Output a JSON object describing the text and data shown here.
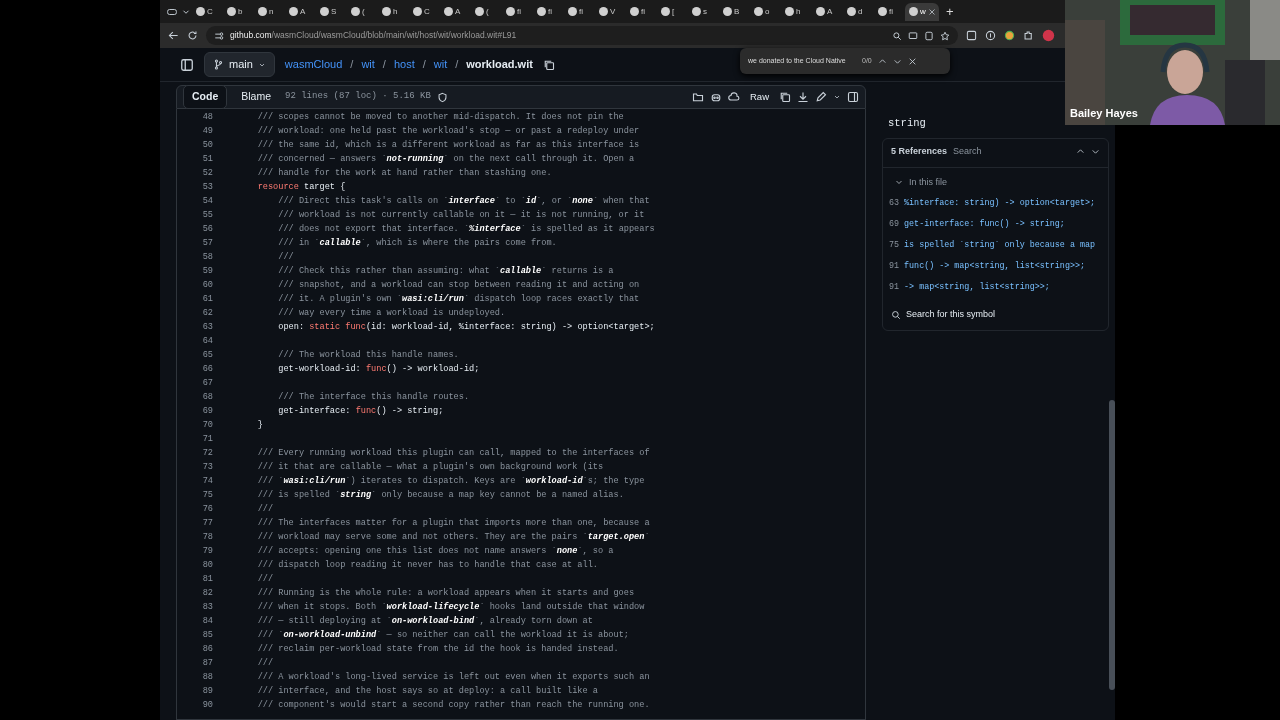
{
  "browser": {
    "tabs": [
      {
        "label": "C",
        "selected": false
      },
      {
        "label": "b",
        "selected": false
      },
      {
        "label": "n",
        "selected": false
      },
      {
        "label": "A",
        "selected": false
      },
      {
        "label": "S",
        "selected": false
      },
      {
        "label": "(",
        "selected": false
      },
      {
        "label": "h",
        "selected": false
      },
      {
        "label": "C",
        "selected": false
      },
      {
        "label": "A",
        "selected": false
      },
      {
        "label": "(",
        "selected": false
      },
      {
        "label": "fi",
        "selected": false
      },
      {
        "label": "fi",
        "selected": false
      },
      {
        "label": "fi",
        "selected": false
      },
      {
        "label": "V",
        "selected": false
      },
      {
        "label": "fi",
        "selected": false
      },
      {
        "label": "[",
        "selected": false
      },
      {
        "label": "s",
        "selected": false
      },
      {
        "label": "B",
        "selected": false
      },
      {
        "label": "o",
        "selected": false
      },
      {
        "label": "h",
        "selected": false
      },
      {
        "label": "A",
        "selected": false
      },
      {
        "label": "d",
        "selected": false
      },
      {
        "label": "fi",
        "selected": false
      },
      {
        "label": "w",
        "selected": true
      }
    ],
    "new_tab": "+",
    "address": {
      "domain": "github.com",
      "path": "/wasmCloud/wasmCloud/blob/main/wit/host/wit/workload.wit#L91"
    },
    "find_bar": {
      "value": "we donated to the Cloud Native",
      "count": "0/0"
    }
  },
  "repo_header": {
    "branch": "main",
    "breadcrumb": [
      "wasmCloud",
      "wit",
      "host",
      "wit"
    ],
    "separator": "/",
    "file": "workload.wit"
  },
  "file_toolbar": {
    "tabs": [
      {
        "label": "Code",
        "selected": true
      },
      {
        "label": "Blame",
        "selected": false
      }
    ],
    "info": "92 lines (87 loc) · 5.16 KB",
    "raw": "Raw"
  },
  "code_lines": [
    {
      "num": "48",
      "segments": [
        {
          "kind": "comment",
          "text": "    /// scopes cannot be moved to another mid-dispatch. It does not pin the"
        }
      ]
    },
    {
      "num": "49",
      "segments": [
        {
          "kind": "comment",
          "text": "    /// workload: one held past the workload's stop — or past a redeploy under"
        }
      ]
    },
    {
      "num": "50",
      "segments": [
        {
          "kind": "comment",
          "text": "    /// the same id, which is a different workload as far as this interface is"
        }
      ]
    },
    {
      "num": "51",
      "segments": [
        {
          "kind": "comment",
          "text": "    /// concerned — answers `"
        },
        {
          "kind": "emphasis",
          "text": "not-running"
        },
        {
          "kind": "comment",
          "text": "` on the next call through it. Open a"
        }
      ]
    },
    {
      "num": "52",
      "segments": [
        {
          "kind": "comment",
          "text": "    /// handle for the work at hand rather than stashing one."
        }
      ]
    },
    {
      "num": "53",
      "segments": [
        {
          "kind": "keyword",
          "text": "    resource"
        },
        {
          "kind": "plain",
          "text": " target {"
        }
      ]
    },
    {
      "num": "54",
      "segments": [
        {
          "kind": "comment",
          "text": "        /// Direct this task's calls on `"
        },
        {
          "kind": "emphasis",
          "text": "interface"
        },
        {
          "kind": "comment",
          "text": "` to `"
        },
        {
          "kind": "emphasis",
          "text": "id"
        },
        {
          "kind": "comment",
          "text": "`, or `"
        },
        {
          "kind": "emphasis",
          "text": "none"
        },
        {
          "kind": "comment",
          "text": "` when that"
        }
      ]
    },
    {
      "num": "55",
      "segments": [
        {
          "kind": "comment",
          "text": "        /// workload is not currently callable on it — it is not running, or it"
        }
      ]
    },
    {
      "num": "56",
      "segments": [
        {
          "kind": "comment",
          "text": "        /// does not export that interface. `"
        },
        {
          "kind": "emphasis",
          "text": "%interface"
        },
        {
          "kind": "comment",
          "text": "` is spelled as it appears"
        }
      ]
    },
    {
      "num": "57",
      "segments": [
        {
          "kind": "comment",
          "text": "        /// in `"
        },
        {
          "kind": "emphasis",
          "text": "callable"
        },
        {
          "kind": "comment",
          "text": "`, which is where the pairs come from."
        }
      ]
    },
    {
      "num": "58",
      "segments": [
        {
          "kind": "comment",
          "text": "        ///"
        }
      ]
    },
    {
      "num": "59",
      "segments": [
        {
          "kind": "comment",
          "text": "        /// Check this rather than assuming: what `"
        },
        {
          "kind": "emphasis",
          "text": "callable"
        },
        {
          "kind": "comment",
          "text": "` returns is a"
        }
      ]
    },
    {
      "num": "60",
      "segments": [
        {
          "kind": "comment",
          "text": "        /// snapshot, and a workload can stop between reading it and acting on"
        }
      ]
    },
    {
      "num": "61",
      "segments": [
        {
          "kind": "comment",
          "text": "        /// it. A plugin's own `"
        },
        {
          "kind": "emphasis",
          "text": "wasi:cli/run"
        },
        {
          "kind": "comment",
          "text": "` dispatch loop races exactly that"
        }
      ]
    },
    {
      "num": "62",
      "segments": [
        {
          "kind": "comment",
          "text": "        /// way every time a workload is undeployed."
        }
      ]
    },
    {
      "num": "63",
      "segments": [
        {
          "kind": "plain",
          "text": "        open: "
        },
        {
          "kind": "keyword",
          "text": "static func"
        },
        {
          "kind": "plain",
          "text": "(id: workload-id, %interface: string) -> option<target>;"
        }
      ]
    },
    {
      "num": "64"
    },
    {
      "num": "65",
      "segments": [
        {
          "kind": "comment",
          "text": "        /// The workload this handle names."
        }
      ]
    },
    {
      "num": "66",
      "segments": [
        {
          "kind": "plain",
          "text": "        get-workload-id: "
        },
        {
          "kind": "keyword",
          "text": "func"
        },
        {
          "kind": "plain",
          "text": "() -> workload-id;"
        }
      ]
    },
    {
      "num": "67"
    },
    {
      "num": "68",
      "segments": [
        {
          "kind": "comment",
          "text": "        /// The interface this handle routes."
        }
      ]
    },
    {
      "num": "69",
      "segments": [
        {
          "kind": "plain",
          "text": "        get-interface: "
        },
        {
          "kind": "keyword",
          "text": "func"
        },
        {
          "kind": "plain",
          "text": "() -> string;"
        }
      ]
    },
    {
      "num": "70",
      "segments": [
        {
          "kind": "plain",
          "text": "    }"
        }
      ]
    },
    {
      "num": "71"
    },
    {
      "num": "72",
      "segments": [
        {
          "kind": "comment",
          "text": "    /// Every running workload this plugin can call, mapped to the interfaces of"
        }
      ]
    },
    {
      "num": "73",
      "segments": [
        {
          "kind": "comment",
          "text": "    /// it that are callable — what a plugin's own background work (its"
        }
      ]
    },
    {
      "num": "74",
      "segments": [
        {
          "kind": "comment",
          "text": "    /// `"
        },
        {
          "kind": "emphasis",
          "text": "wasi:cli/run"
        },
        {
          "kind": "comment",
          "text": "`) iterates to dispatch. Keys are `"
        },
        {
          "kind": "emphasis",
          "text": "workload-id"
        },
        {
          "kind": "comment",
          "text": "`s; the type"
        }
      ]
    },
    {
      "num": "75",
      "segments": [
        {
          "kind": "comment",
          "text": "    /// is spelled `"
        },
        {
          "kind": "emphasis",
          "text": "string"
        },
        {
          "kind": "comment",
          "text": "` only because a map key cannot be a named alias."
        }
      ]
    },
    {
      "num": "76",
      "segments": [
        {
          "kind": "comment",
          "text": "    ///"
        }
      ]
    },
    {
      "num": "77",
      "segments": [
        {
          "kind": "comment",
          "text": "    /// The interfaces matter for a plugin that imports more than one, because a"
        }
      ]
    },
    {
      "num": "78",
      "segments": [
        {
          "kind": "comment",
          "text": "    /// workload may serve some and not others. They are the pairs `"
        },
        {
          "kind": "emphasis",
          "text": "target.open"
        },
        {
          "kind": "comment",
          "text": "`"
        }
      ]
    },
    {
      "num": "79",
      "segments": [
        {
          "kind": "comment",
          "text": "    /// accepts: opening one this list does not name answers `"
        },
        {
          "kind": "emphasis",
          "text": "none"
        },
        {
          "kind": "comment",
          "text": "`, so a"
        }
      ]
    },
    {
      "num": "80",
      "segments": [
        {
          "kind": "comment",
          "text": "    /// dispatch loop reading it never has to handle that case at all."
        }
      ]
    },
    {
      "num": "81",
      "segments": [
        {
          "kind": "comment",
          "text": "    ///"
        }
      ]
    },
    {
      "num": "82",
      "segments": [
        {
          "kind": "comment",
          "text": "    /// Running is the whole rule: a workload appears when it starts and goes"
        }
      ]
    },
    {
      "num": "83",
      "segments": [
        {
          "kind": "comment",
          "text": "    /// when it stops. Both `"
        },
        {
          "kind": "emphasis",
          "text": "workload-lifecycle"
        },
        {
          "kind": "comment",
          "text": "` hooks land outside that window"
        }
      ]
    },
    {
      "num": "84",
      "segments": [
        {
          "kind": "comment",
          "text": "    /// — still deploying at `"
        },
        {
          "kind": "emphasis",
          "text": "on-workload-bind"
        },
        {
          "kind": "comment",
          "text": "`, already torn down at"
        }
      ]
    },
    {
      "num": "85",
      "segments": [
        {
          "kind": "comment",
          "text": "    /// `"
        },
        {
          "kind": "emphasis",
          "text": "on-workload-unbind"
        },
        {
          "kind": "comment",
          "text": "` — so neither can call the workload it is about;"
        }
      ]
    },
    {
      "num": "86",
      "segments": [
        {
          "kind": "comment",
          "text": "    /// reclaim per-workload state from the id the hook is handed instead."
        }
      ]
    },
    {
      "num": "87",
      "segments": [
        {
          "kind": "comment",
          "text": "    ///"
        }
      ]
    },
    {
      "num": "88",
      "segments": [
        {
          "kind": "comment",
          "text": "    /// A workload's long-lived service is left out even when it exports such an"
        }
      ]
    },
    {
      "num": "89",
      "segments": [
        {
          "kind": "comment",
          "text": "    /// interface, and the host says so at deploy: a call built like a"
        }
      ]
    },
    {
      "num": "90",
      "segments": [
        {
          "kind": "comment",
          "text": "    /// component's would start a second copy rather than reach the running one."
        }
      ]
    }
  ],
  "symbol_panel": {
    "symbol": "string",
    "tabs": [
      {
        "label": "5 References",
        "selected": true
      },
      {
        "label": "Search",
        "selected": false
      }
    ],
    "group": {
      "label": "In this file",
      "expanded": true
    },
    "references": [
      {
        "num": "63",
        "text": "%interface: string) -> option<target>;"
      },
      {
        "num": "69",
        "text": "get-interface: func() -> string;"
      },
      {
        "num": "75",
        "text": "is spelled `string` only because a map"
      },
      {
        "num": "91",
        "text": "func() -> map<string, list<string>>;"
      },
      {
        "num": "91",
        "text": "-> map<string, list<string>>;"
      }
    ],
    "search_link": "Search for this symbol"
  },
  "video_tile": {
    "name": "Bailey Hayes"
  }
}
